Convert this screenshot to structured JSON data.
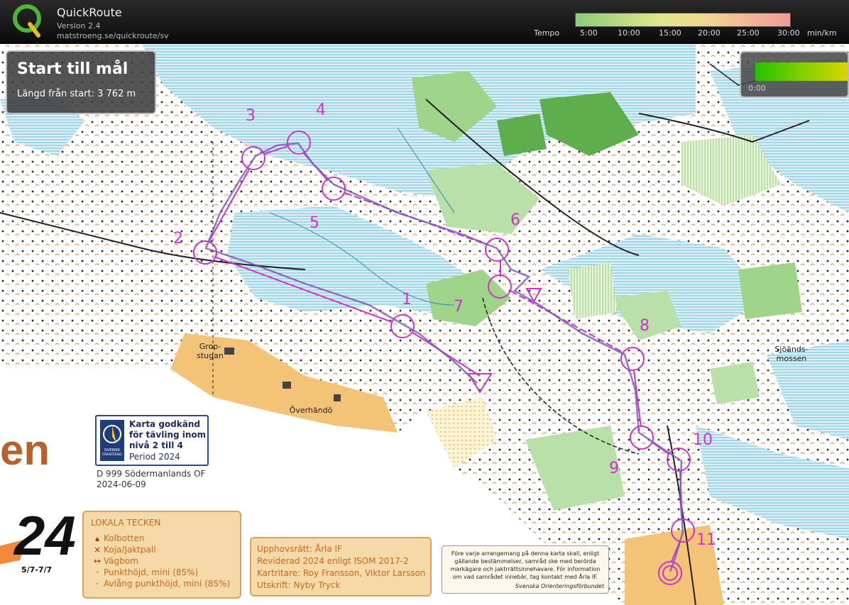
{
  "app": {
    "name": "QuickRoute",
    "version": "Version 2.4",
    "url": "matstroeng.se/quickroute/sv"
  },
  "tempo": {
    "label": "Tempo",
    "ticks": [
      "5:00",
      "10:00",
      "15:00",
      "20:00",
      "25:00",
      "30:00"
    ],
    "unit": "min/km"
  },
  "info": {
    "title": "Start till mål",
    "length_text": "Längd från start: 3 762 m"
  },
  "mini_panel": {
    "value": "0:00"
  },
  "approval": {
    "line1": "Karta godkänd",
    "line2": "för tävling inom",
    "line3": "nivå 2 till 4",
    "period": "Period 2024",
    "logo_text_1": "SVENSK",
    "logo_text_2": "ORIENTERING"
  },
  "map_info": {
    "club": "D 999 Södermanlands OF",
    "date": "2024-06-09",
    "big_text": "en",
    "year": "24",
    "dates": "5/7-7/7"
  },
  "places": [
    {
      "name": "Grop-",
      "name2": "stugan"
    },
    {
      "name": "Överhändö",
      "name2": ""
    },
    {
      "name": "Sjöänds-",
      "name2": "mossen"
    }
  ],
  "legend": {
    "title": "LOKALA TECKEN",
    "items": [
      {
        "symbol": "▴",
        "label": "Kolbotten"
      },
      {
        "symbol": "×",
        "label": "Koja/Jaktpall"
      },
      {
        "symbol": "↔",
        "label": "Vägbom"
      },
      {
        "symbol": "·",
        "label": "Punkthöjd, mini (85%)"
      },
      {
        "symbol": "·",
        "label": "Avlång punkthöjd, mini (85%)"
      }
    ]
  },
  "credits": [
    "Upphovsrätt: Årla IF",
    "Reviderad 2024 enligt ISOM 2017-2",
    "Kartritare: Roy Fransson, Viktor Larsson",
    "Utskrift: Nyby Tryck"
  ],
  "notice": [
    "Före varje arrangemang på denna karta skall, enligt",
    "gällande bestämmelser, samråd ske med berörda",
    "markägare och jaktrrättsinnehavare. För information",
    "om vad samrådet innebär, tag kontakt med Årla IF.",
    "Svenska Orienteringsförbundet"
  ],
  "controls": [
    "1",
    "2",
    "3",
    "4",
    "5",
    "6",
    "7",
    "8",
    "9",
    "10",
    "11"
  ],
  "colors": {
    "course": "#cc33cc",
    "water": "#bfe6f2",
    "forest_green": "#9fd48a",
    "open_land": "#f3c477"
  }
}
